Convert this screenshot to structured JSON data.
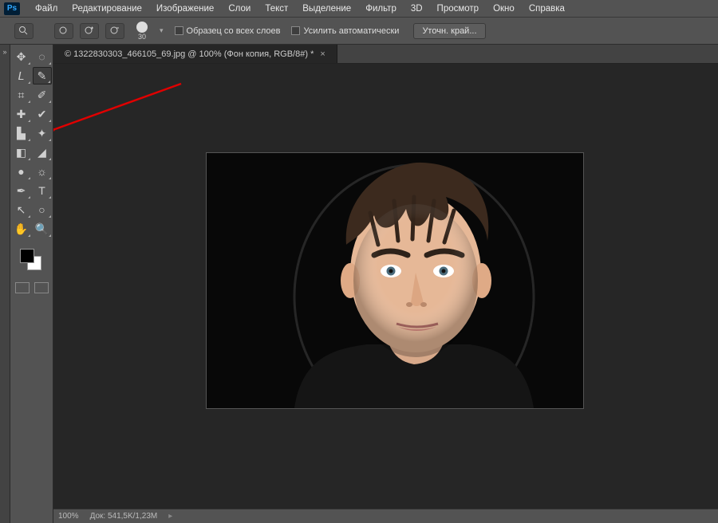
{
  "menu": {
    "items": [
      "Файл",
      "Редактирование",
      "Изображение",
      "Слои",
      "Текст",
      "Выделение",
      "Фильтр",
      "3D",
      "Просмотр",
      "Окно",
      "Справка"
    ]
  },
  "options": {
    "brush_size": "30",
    "chk1_label": "Образец со всех слоев",
    "chk2_label": "Усилить автоматически",
    "refine_btn": "Уточн. край..."
  },
  "document": {
    "tab_title": "© 1322830303_466105_69.jpg @ 100% (Фон копия, RGB/8#) *"
  },
  "status": {
    "zoom": "100%",
    "info": "Док: 541,5K/1,23M"
  },
  "tools": [
    {
      "name": "move-tool",
      "glyph": "✥"
    },
    {
      "name": "marquee-tool",
      "glyph": "◌"
    },
    {
      "name": "lasso-tool",
      "glyph": "𝘓"
    },
    {
      "name": "quick-select-tool",
      "glyph": "✎",
      "active": true
    },
    {
      "name": "crop-tool",
      "glyph": "⌗"
    },
    {
      "name": "eyedropper-tool",
      "glyph": "✐"
    },
    {
      "name": "healing-tool",
      "glyph": "✚"
    },
    {
      "name": "brush-tool",
      "glyph": "✔"
    },
    {
      "name": "stamp-tool",
      "glyph": "▙"
    },
    {
      "name": "history-brush-tool",
      "glyph": "✦"
    },
    {
      "name": "eraser-tool",
      "glyph": "◧"
    },
    {
      "name": "gradient-tool",
      "glyph": "◢"
    },
    {
      "name": "blur-tool",
      "glyph": "●"
    },
    {
      "name": "dodge-tool",
      "glyph": "☼"
    },
    {
      "name": "pen-tool",
      "glyph": "✒"
    },
    {
      "name": "type-tool",
      "glyph": "T"
    },
    {
      "name": "path-select-tool",
      "glyph": "↖"
    },
    {
      "name": "shape-tool",
      "glyph": "○"
    },
    {
      "name": "hand-tool",
      "glyph": "✋"
    },
    {
      "name": "zoom-tool",
      "glyph": "🔍"
    }
  ]
}
